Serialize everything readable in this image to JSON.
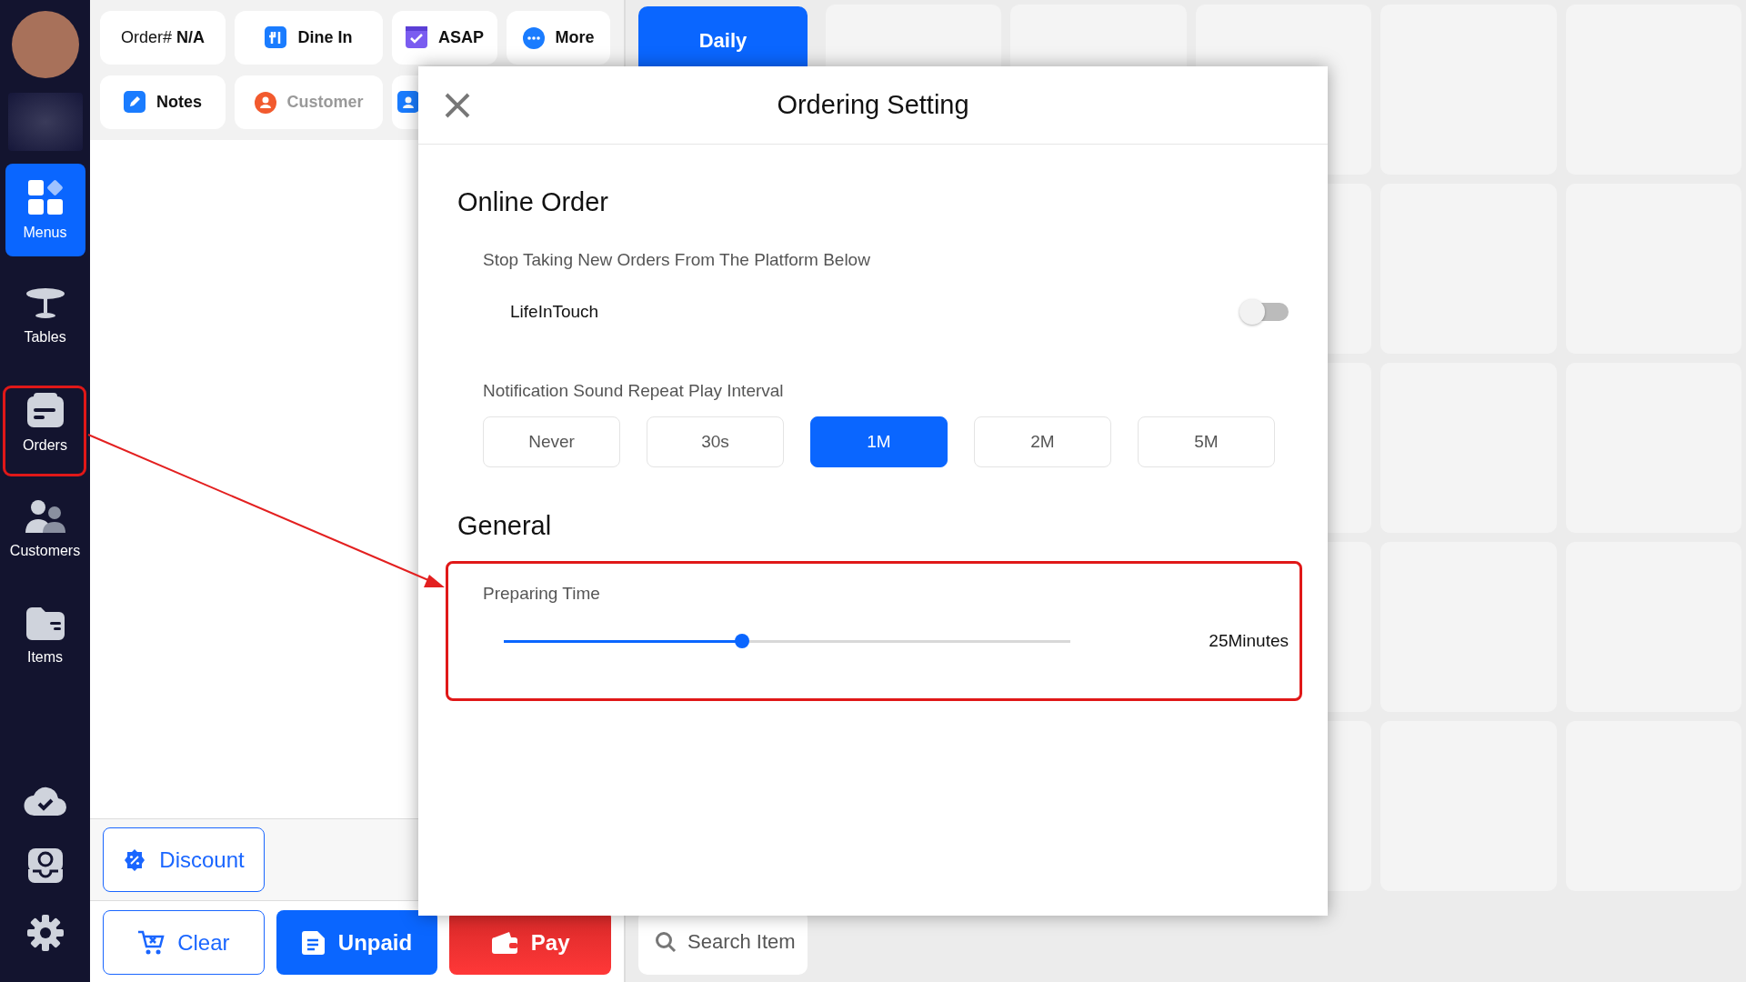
{
  "sidebar": {
    "items": [
      {
        "kind": "menus",
        "label": "Menus",
        "selected": true
      },
      {
        "kind": "tables",
        "label": "Tables",
        "selected": false
      },
      {
        "kind": "orders",
        "label": "Orders",
        "selected": false
      },
      {
        "kind": "customers",
        "label": "Customers",
        "selected": false
      },
      {
        "kind": "items",
        "label": "Items",
        "selected": false
      }
    ]
  },
  "order_bar": {
    "order": "Order# **N/A**",
    "buttons": [
      {
        "kind": "dine",
        "label": "Dine In",
        "disabled": false
      },
      {
        "kind": "asap",
        "label": "ASAP",
        "disabled": false
      },
      {
        "kind": "more",
        "label": "More",
        "disabled": false
      },
      {
        "kind": "notes",
        "label": "Notes",
        "disabled": false
      },
      {
        "kind": "customer",
        "label": "Customer",
        "disabled": true
      }
    ]
  },
  "actions": [
    {
      "kind": "discount",
      "label": "Discount"
    },
    {
      "kind": "clear",
      "label": "Clear"
    },
    {
      "kind": "unpaid",
      "label": "Unpaid"
    },
    {
      "kind": "pay",
      "label": "Pay"
    }
  ],
  "categories": [
    {
      "label": "Daily",
      "selected": true
    }
  ],
  "search": {
    "placeholder": "Search Item"
  },
  "modal": {
    "title": "Ordering Setting",
    "online_order": {
      "heading": "Online Order",
      "platform_label": "Stop Taking New Orders From The Platform Below",
      "platforms": [
        {
          "name": "LifeInTouch",
          "on": false
        }
      ],
      "interval_label": "Notification Sound Repeat Play Interval",
      "intervals": [
        {
          "label": "Never",
          "selected": false
        },
        {
          "label": "30s",
          "selected": false
        },
        {
          "label": "1M",
          "selected": true
        },
        {
          "label": "2M",
          "selected": false
        },
        {
          "label": "5M",
          "selected": false
        }
      ]
    },
    "general": {
      "heading": "General",
      "preparing_time": {
        "label": "Preparing Time",
        "level": 0.42,
        "reading": "25Minutes"
      }
    }
  }
}
